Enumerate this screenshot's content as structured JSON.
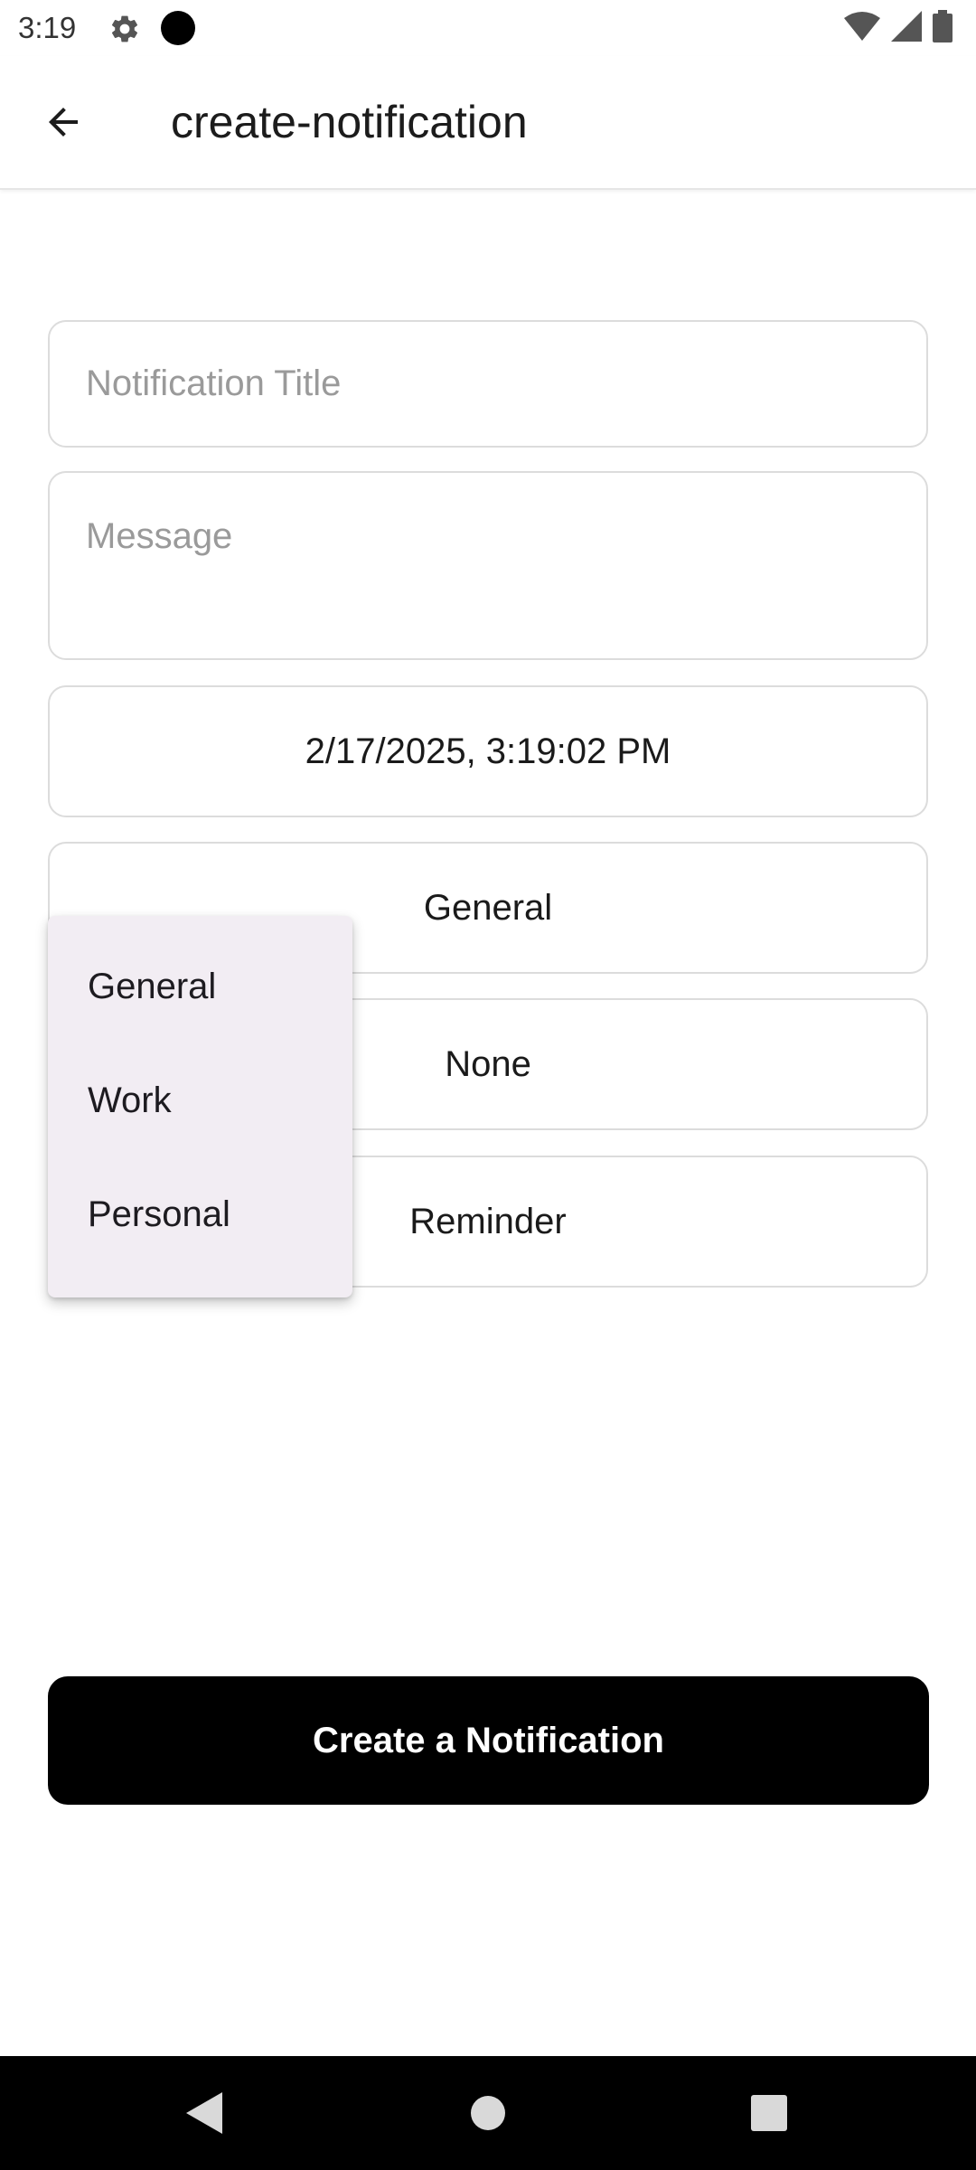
{
  "status_bar": {
    "time": "3:19",
    "icons": [
      "settings-icon",
      "camera-dot-icon",
      "wifi-icon",
      "signal-icon",
      "battery-icon"
    ]
  },
  "app_bar": {
    "title": "create-notification",
    "back_icon": "arrow-left-icon"
  },
  "form": {
    "title_placeholder": "Notification Title",
    "title_value": "",
    "message_placeholder": "Message",
    "message_value": "",
    "date_value": "2/17/2025, 3:19:02 PM",
    "category_value": "General",
    "priority_value": "None",
    "type_value": "Reminder"
  },
  "dropdown": {
    "options": [
      "General",
      "Work",
      "Personal"
    ]
  },
  "actions": {
    "create_label": "Create a Notification"
  },
  "nav_bar": {
    "icons": [
      "back-triangle-icon",
      "home-circle-icon",
      "recents-square-icon"
    ]
  },
  "colors": {
    "primary_button": "#000000",
    "menu_background": "#f2edf3",
    "field_border": "#dcdcdc",
    "placeholder": "#9a9a9a"
  }
}
